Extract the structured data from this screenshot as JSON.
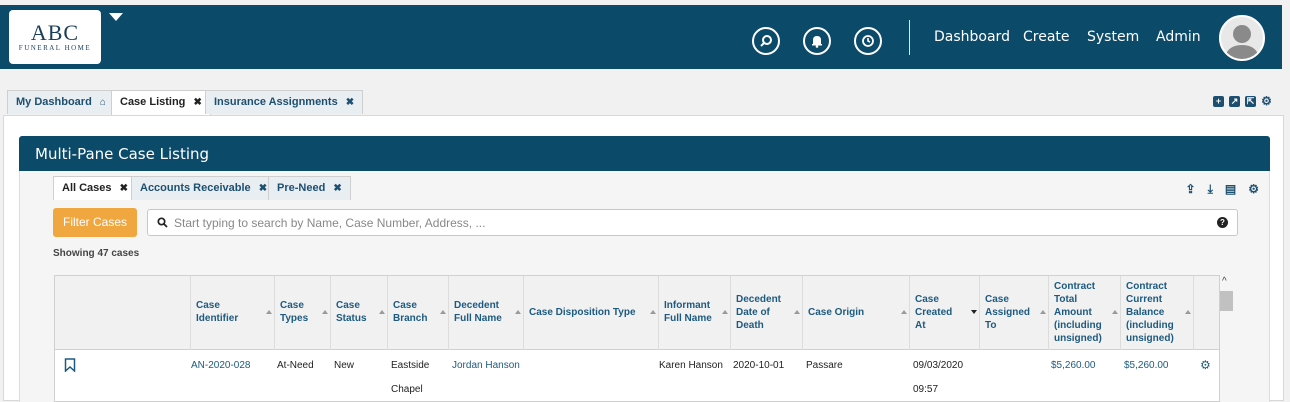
{
  "header": {
    "logo_main": "ABC",
    "logo_sub": "FUNERAL HOME",
    "icons": [
      "search-icon",
      "bell-icon",
      "clock-icon"
    ],
    "nav": [
      "Dashboard",
      "Create",
      "System",
      "Admin"
    ]
  },
  "page_tabs": [
    {
      "label": "My Dashboard",
      "icon": "home-icon"
    },
    {
      "label": "Case Listing",
      "icon": "close-icon"
    },
    {
      "label": "Insurance Assignments",
      "icon": "close-icon"
    }
  ],
  "panel": {
    "title": "Multi-Pane Case Listing",
    "sub_tabs": [
      "All Cases",
      "Accounts Receivable",
      "Pre-Need"
    ],
    "filter_label": "Filter Cases",
    "search_placeholder": "Start typing to search by Name, Case Number, Address, ...",
    "showing": "Showing 47 cases"
  },
  "table": {
    "columns": [
      [
        "Case",
        "Identifier"
      ],
      [
        "Case",
        "Types"
      ],
      [
        "Case",
        "Status"
      ],
      [
        "Case",
        "Branch"
      ],
      [
        "Decedent",
        "Full Name"
      ],
      [
        "Case Disposition Type"
      ],
      [
        "Informant",
        "Full Name"
      ],
      [
        "Decedent",
        "Date of",
        "Death"
      ],
      [
        "Case Origin"
      ],
      [
        "Case",
        "Created",
        "At"
      ],
      [
        "Case",
        "Assigned",
        "To"
      ],
      [
        "Contract",
        "Total",
        "Amount",
        "(including",
        "unsigned)"
      ],
      [
        "Contract",
        "Current",
        "Balance",
        "(including",
        "unsigned)"
      ]
    ],
    "rows": [
      {
        "case_identifier": "AN-2020-028",
        "case_types": "At-Need",
        "case_status": "New",
        "case_branch": [
          "Eastside",
          "Chapel"
        ],
        "decedent_full_name": "Jordan Hanson",
        "informant_full_name": "Karen Hanson",
        "date_of_death": "2020-10-01",
        "case_origin": "Passare",
        "created_at": [
          "09/03/2020",
          "09:57"
        ],
        "contract_total": "$5,260.00",
        "contract_balance": "$5,260.00"
      }
    ]
  },
  "colors": {
    "primary": "#0c4a6a",
    "accent": "#f0a740",
    "link": "#1d5a80"
  }
}
